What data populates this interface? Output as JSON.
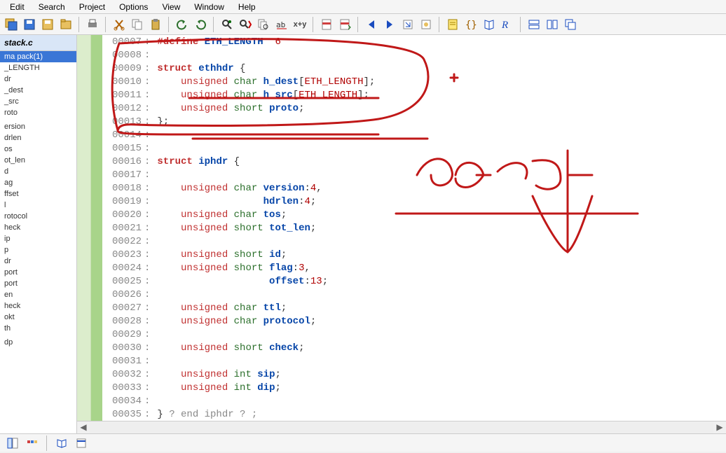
{
  "menu": [
    "Edit",
    "Search",
    "Project",
    "Options",
    "View",
    "Window",
    "Help"
  ],
  "toolbar_icons": [
    "save-all-icon",
    "save-icon",
    "save-as-icon",
    "save-project-icon",
    "SEP",
    "print-icon",
    "SEP",
    "cut-icon",
    "copy-icon",
    "paste-icon",
    "SEP",
    "undo-icon",
    "redo-icon",
    "SEP",
    "find-icon",
    "find-next-icon",
    "find-files-icon",
    "replace-icon",
    "xy-icon",
    "SEP",
    "bookmark-toggle-icon",
    "bookmark-next-icon",
    "SEP",
    "nav-back-icon",
    "nav-fwd-icon",
    "jump-icon",
    "jump-def-icon",
    "SEP",
    "context-icon",
    "bracket-icon",
    "book-icon",
    "relation-icon",
    "SEP",
    "window-tile-h-icon",
    "window-tile-v-icon",
    "window-cascade-icon"
  ],
  "file_tab": "stack.c",
  "symbols": [
    {
      "label": "ma pack(1)",
      "hl": true
    },
    {
      "label": "_LENGTH"
    },
    {
      "label": "dr"
    },
    {
      "label": "_dest"
    },
    {
      "label": "_src"
    },
    {
      "label": "roto"
    },
    {
      "label": ""
    },
    {
      "label": "ersion"
    },
    {
      "label": "drlen"
    },
    {
      "label": "os"
    },
    {
      "label": "ot_len"
    },
    {
      "label": "d"
    },
    {
      "label": "ag"
    },
    {
      "label": "ffset"
    },
    {
      "label": "l"
    },
    {
      "label": "rotocol"
    },
    {
      "label": "heck"
    },
    {
      "label": "ip"
    },
    {
      "label": "p"
    },
    {
      "label": "dr"
    },
    {
      "label": "port"
    },
    {
      "label": "port"
    },
    {
      "label": "en"
    },
    {
      "label": "heck"
    },
    {
      "label": "okt"
    },
    {
      "label": "th"
    },
    {
      "label": ""
    },
    {
      "label": "dp"
    }
  ],
  "lines": [
    {
      "n": "00007",
      "tokens": [
        {
          "t": "#define",
          "c": "kw2"
        },
        {
          "t": " "
        },
        {
          "t": "ETH_LENGTH",
          "c": "name"
        },
        {
          "t": "  "
        },
        {
          "t": "6",
          "c": "num"
        }
      ]
    },
    {
      "n": "00008",
      "tokens": []
    },
    {
      "n": "00009",
      "tokens": [
        {
          "t": "struct",
          "c": "kw2"
        },
        {
          "t": " "
        },
        {
          "t": "ethhdr",
          "c": "name"
        },
        {
          "t": " {",
          "c": "sym"
        }
      ]
    },
    {
      "n": "00010",
      "tokens": [
        {
          "t": "    "
        },
        {
          "t": "unsigned",
          "c": "kw"
        },
        {
          "t": " "
        },
        {
          "t": "char",
          "c": "type"
        },
        {
          "t": " "
        },
        {
          "t": "h_dest",
          "c": "mem"
        },
        {
          "t": "[",
          "c": "sym"
        },
        {
          "t": "ETH_LENGTH",
          "c": "num"
        },
        {
          "t": "];",
          "c": "sym"
        }
      ]
    },
    {
      "n": "00011",
      "tokens": [
        {
          "t": "    "
        },
        {
          "t": "unsigned",
          "c": "kw"
        },
        {
          "t": " "
        },
        {
          "t": "char",
          "c": "type"
        },
        {
          "t": " "
        },
        {
          "t": "h_src",
          "c": "mem"
        },
        {
          "t": "[",
          "c": "sym"
        },
        {
          "t": "ETH_LENGTH",
          "c": "num"
        },
        {
          "t": "];",
          "c": "sym"
        }
      ]
    },
    {
      "n": "00012",
      "tokens": [
        {
          "t": "    "
        },
        {
          "t": "unsigned",
          "c": "kw"
        },
        {
          "t": " "
        },
        {
          "t": "short",
          "c": "type"
        },
        {
          "t": " "
        },
        {
          "t": "proto",
          "c": "mem"
        },
        {
          "t": ";",
          "c": "sym"
        }
      ]
    },
    {
      "n": "00013",
      "tokens": [
        {
          "t": "};",
          "c": "sym"
        }
      ]
    },
    {
      "n": "00014",
      "tokens": []
    },
    {
      "n": "00015",
      "tokens": []
    },
    {
      "n": "00016",
      "tokens": [
        {
          "t": "struct",
          "c": "kw2"
        },
        {
          "t": " "
        },
        {
          "t": "iphdr",
          "c": "name"
        },
        {
          "t": " {",
          "c": "sym"
        }
      ]
    },
    {
      "n": "00017",
      "tokens": []
    },
    {
      "n": "00018",
      "tokens": [
        {
          "t": "    "
        },
        {
          "t": "unsigned",
          "c": "kw"
        },
        {
          "t": " "
        },
        {
          "t": "char",
          "c": "type"
        },
        {
          "t": " "
        },
        {
          "t": "version",
          "c": "mem"
        },
        {
          "t": ":",
          "c": "sym"
        },
        {
          "t": "4",
          "c": "num"
        },
        {
          "t": ",",
          "c": "sym"
        }
      ]
    },
    {
      "n": "00019",
      "tokens": [
        {
          "t": "                  "
        },
        {
          "t": "hdrlen",
          "c": "mem"
        },
        {
          "t": ":",
          "c": "sym"
        },
        {
          "t": "4",
          "c": "num"
        },
        {
          "t": ";",
          "c": "sym"
        }
      ]
    },
    {
      "n": "00020",
      "tokens": [
        {
          "t": "    "
        },
        {
          "t": "unsigned",
          "c": "kw"
        },
        {
          "t": " "
        },
        {
          "t": "char",
          "c": "type"
        },
        {
          "t": " "
        },
        {
          "t": "tos",
          "c": "mem"
        },
        {
          "t": ";",
          "c": "sym"
        }
      ]
    },
    {
      "n": "00021",
      "tokens": [
        {
          "t": "    "
        },
        {
          "t": "unsigned",
          "c": "kw"
        },
        {
          "t": " "
        },
        {
          "t": "short",
          "c": "type"
        },
        {
          "t": " "
        },
        {
          "t": "tot_len",
          "c": "mem"
        },
        {
          "t": ";",
          "c": "sym"
        }
      ]
    },
    {
      "n": "00022",
      "tokens": []
    },
    {
      "n": "00023",
      "tokens": [
        {
          "t": "    "
        },
        {
          "t": "unsigned",
          "c": "kw"
        },
        {
          "t": " "
        },
        {
          "t": "short",
          "c": "type"
        },
        {
          "t": " "
        },
        {
          "t": "id",
          "c": "mem"
        },
        {
          "t": ";",
          "c": "sym"
        }
      ]
    },
    {
      "n": "00024",
      "tokens": [
        {
          "t": "    "
        },
        {
          "t": "unsigned",
          "c": "kw"
        },
        {
          "t": " "
        },
        {
          "t": "short",
          "c": "type"
        },
        {
          "t": " "
        },
        {
          "t": "flag",
          "c": "mem"
        },
        {
          "t": ":",
          "c": "sym"
        },
        {
          "t": "3",
          "c": "num"
        },
        {
          "t": ",",
          "c": "sym"
        }
      ]
    },
    {
      "n": "00025",
      "tokens": [
        {
          "t": "                   "
        },
        {
          "t": "offset",
          "c": "mem"
        },
        {
          "t": ":",
          "c": "sym"
        },
        {
          "t": "13",
          "c": "num"
        },
        {
          "t": ";",
          "c": "sym"
        }
      ]
    },
    {
      "n": "00026",
      "tokens": []
    },
    {
      "n": "00027",
      "tokens": [
        {
          "t": "    "
        },
        {
          "t": "unsigned",
          "c": "kw"
        },
        {
          "t": " "
        },
        {
          "t": "char",
          "c": "type"
        },
        {
          "t": " "
        },
        {
          "t": "ttl",
          "c": "mem"
        },
        {
          "t": ";",
          "c": "sym"
        }
      ]
    },
    {
      "n": "00028",
      "tokens": [
        {
          "t": "    "
        },
        {
          "t": "unsigned",
          "c": "kw"
        },
        {
          "t": " "
        },
        {
          "t": "char",
          "c": "type"
        },
        {
          "t": " "
        },
        {
          "t": "protocol",
          "c": "mem"
        },
        {
          "t": ";",
          "c": "sym"
        }
      ]
    },
    {
      "n": "00029",
      "tokens": []
    },
    {
      "n": "00030",
      "tokens": [
        {
          "t": "    "
        },
        {
          "t": "unsigned",
          "c": "kw"
        },
        {
          "t": " "
        },
        {
          "t": "short",
          "c": "type"
        },
        {
          "t": " "
        },
        {
          "t": "check",
          "c": "mem"
        },
        {
          "t": ";",
          "c": "sym"
        }
      ]
    },
    {
      "n": "00031",
      "tokens": []
    },
    {
      "n": "00032",
      "tokens": [
        {
          "t": "    "
        },
        {
          "t": "unsigned",
          "c": "kw"
        },
        {
          "t": " "
        },
        {
          "t": "int",
          "c": "type"
        },
        {
          "t": " "
        },
        {
          "t": "sip",
          "c": "mem"
        },
        {
          "t": ";",
          "c": "sym"
        }
      ]
    },
    {
      "n": "00033",
      "tokens": [
        {
          "t": "    "
        },
        {
          "t": "unsigned",
          "c": "kw"
        },
        {
          "t": " "
        },
        {
          "t": "int",
          "c": "type"
        },
        {
          "t": " "
        },
        {
          "t": "dip",
          "c": "mem"
        },
        {
          "t": ";",
          "c": "sym"
        }
      ]
    },
    {
      "n": "00034",
      "tokens": []
    },
    {
      "n": "00035",
      "tokens": [
        {
          "t": "} ",
          "c": "sym"
        },
        {
          "t": "? end iphdr ? ;",
          "c": "cmt"
        }
      ]
    }
  ],
  "bottom_icons": [
    "symbol-window-icon",
    "mini-toolbar-icon",
    "SEP",
    "book-open-icon",
    "new-window-icon"
  ],
  "annotation_color": "#c01818",
  "xy_label": "x+y"
}
